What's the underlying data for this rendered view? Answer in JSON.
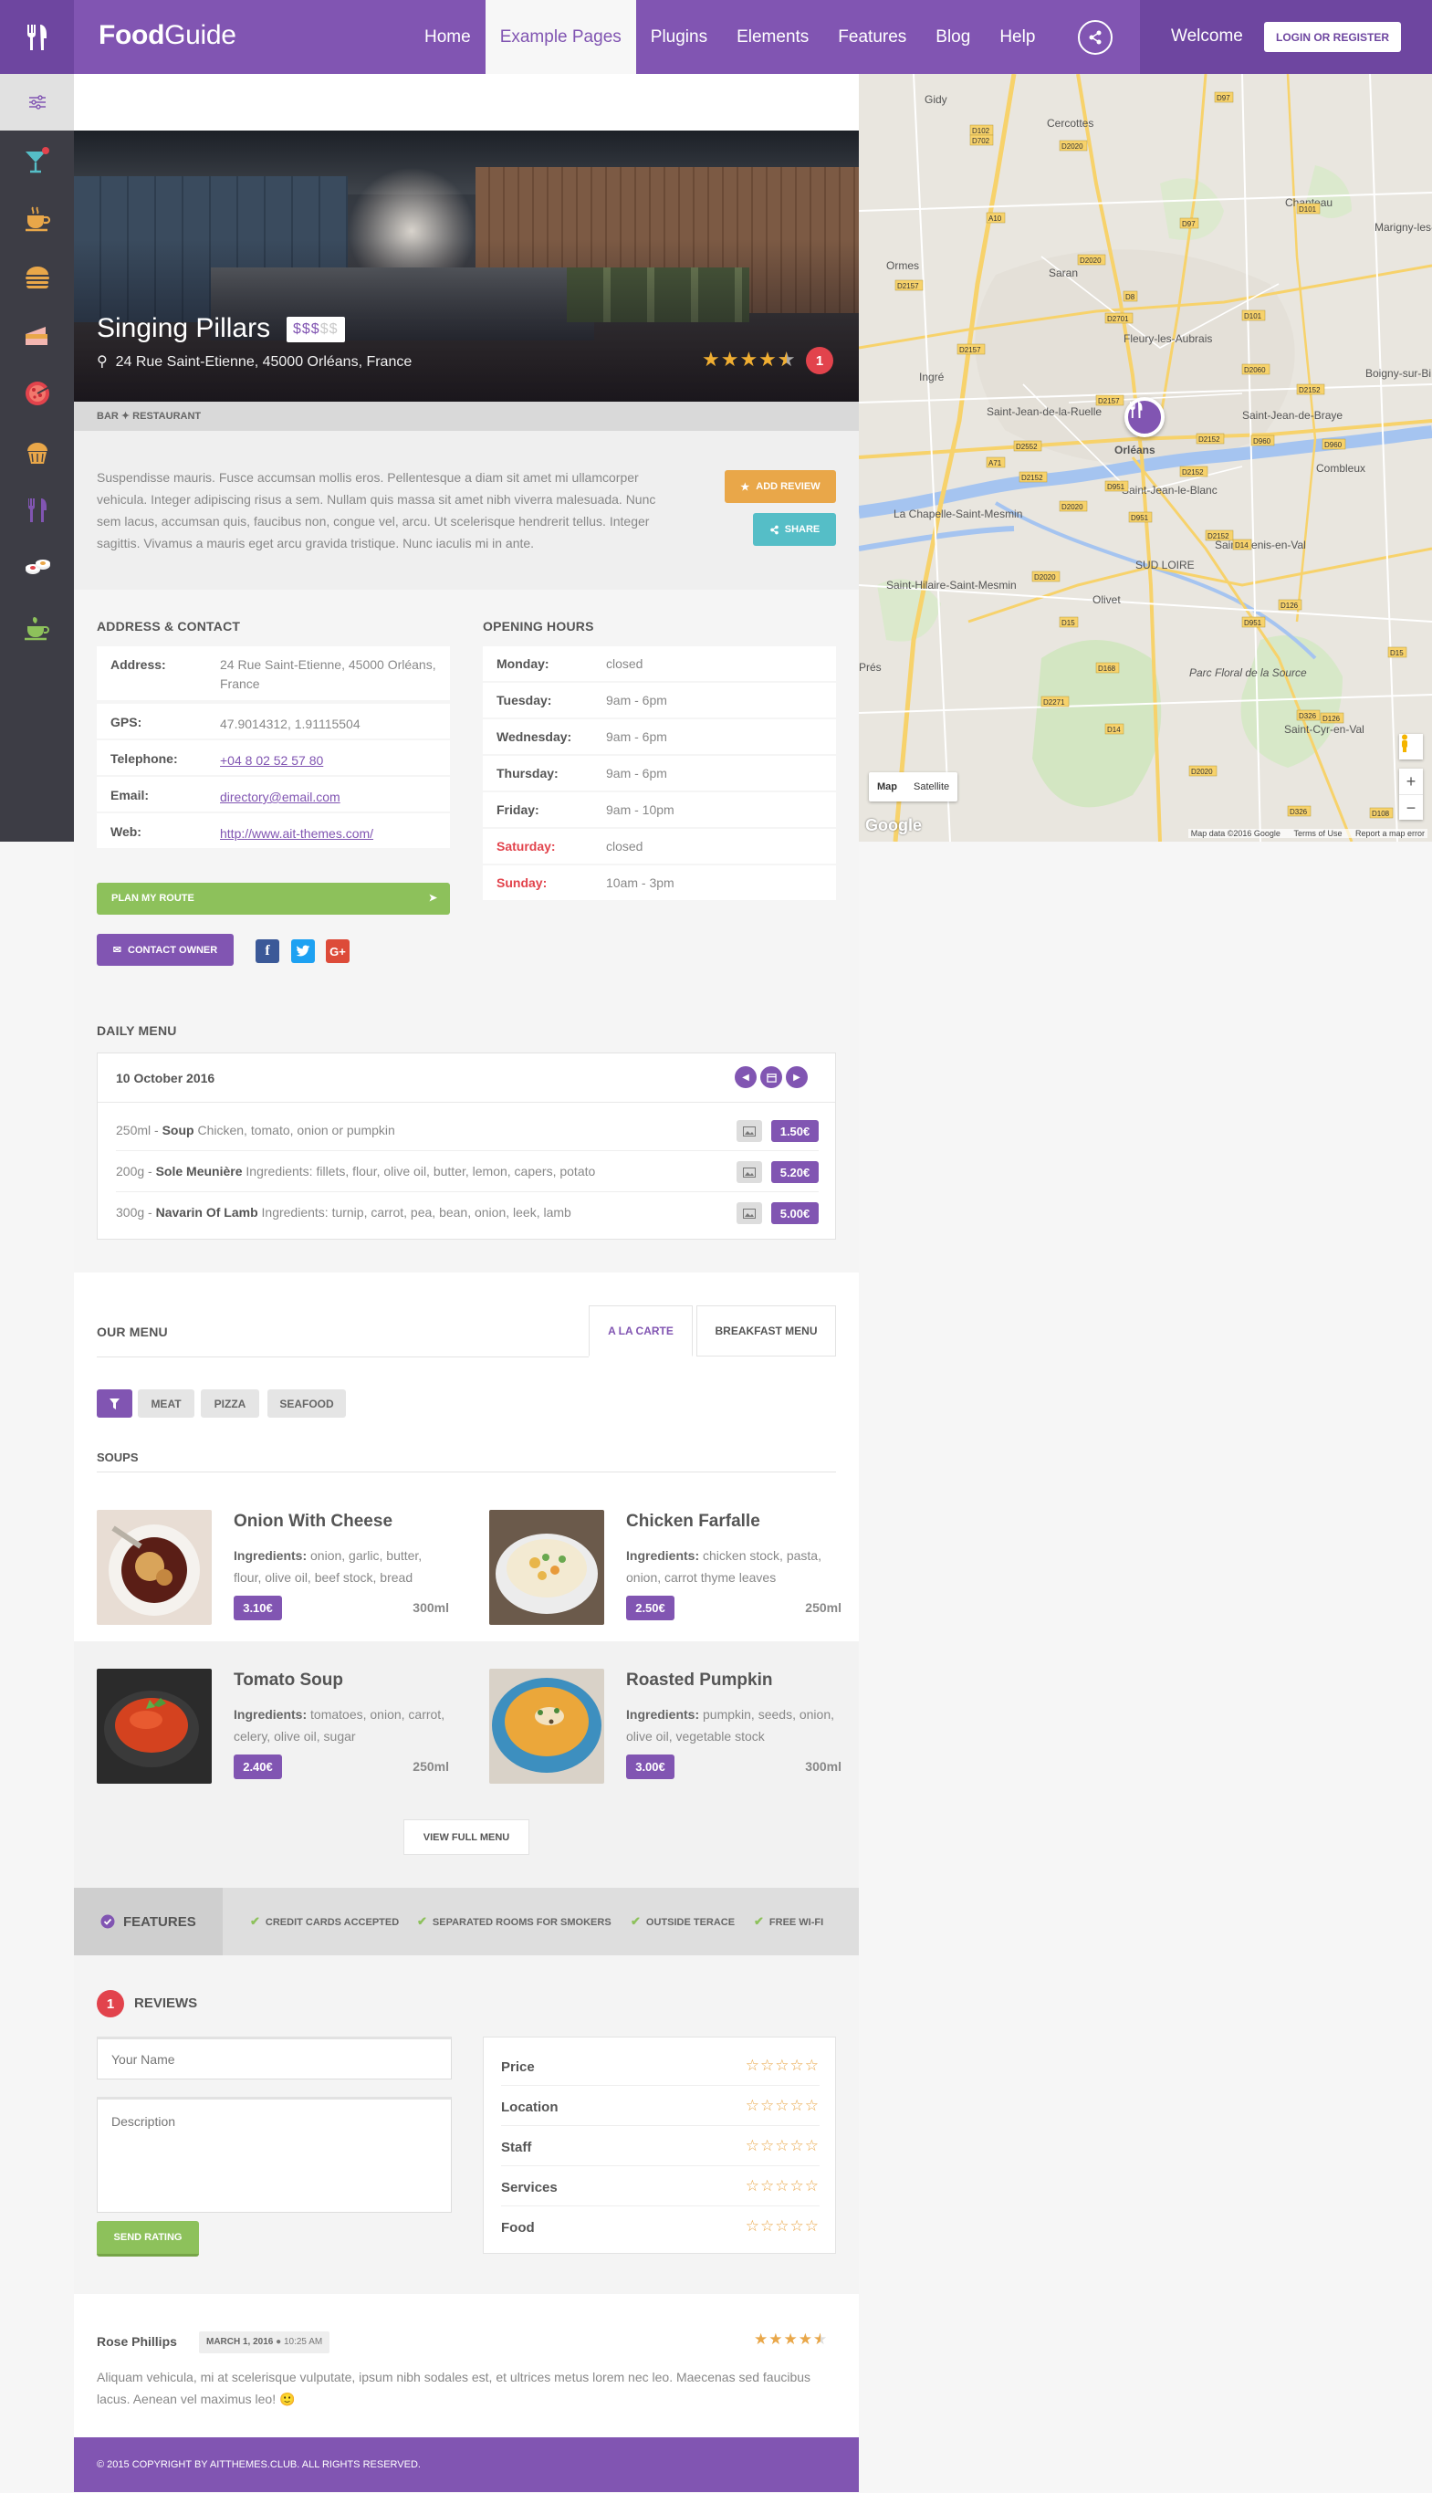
{
  "header": {
    "brand_bold": "Food",
    "brand_light": "Guide",
    "nav": [
      {
        "label": "Home",
        "active": false
      },
      {
        "label": "Example Pages",
        "active": true
      },
      {
        "label": "Plugins",
        "active": false
      },
      {
        "label": "Elements",
        "active": false
      },
      {
        "label": "Features",
        "active": false
      },
      {
        "label": "Blog",
        "active": false
      },
      {
        "label": "Help",
        "active": false
      }
    ],
    "welcome": "Welcome",
    "login_label": "LOGIN OR REGISTER"
  },
  "sidebar": {
    "categories": [
      "cocktail-icon",
      "coffee-icon",
      "burger-icon",
      "cake-icon",
      "pizza-icon",
      "muffin-icon",
      "cutlery-icon",
      "sushi-icon",
      "tea-icon"
    ]
  },
  "listing": {
    "title": "Singing Pillars",
    "price_on": "$$$",
    "price_off": "$$",
    "address": "24 Rue Saint-Etienne, 45000 Orléans, France",
    "rating": 4.5,
    "review_count": "1",
    "categories": "BAR ✦ RESTAURANT",
    "description": "Suspendisse mauris. Fusce accumsan mollis eros. Pellentesque a diam sit amet mi ullamcorper vehicula. Integer adipiscing risus a sem. Nullam quis massa sit amet nibh viverra malesuada. Nunc sem lacus, accumsan quis, faucibus non, congue vel, arcu. Ut scelerisque hendrerit tellus. Integer sagittis. Vivamus a mauris eget arcu gravida tristique. Nunc iaculis mi in ante.",
    "add_review_label": "ADD REVIEW",
    "share_label": "SHARE"
  },
  "contact": {
    "title": "ADDRESS & CONTACT",
    "rows": [
      {
        "label": "Address:",
        "value": "24 Rue Saint-Etienne, 45000 Orléans, France"
      },
      {
        "label": "GPS:",
        "value": "47.9014312, 1.91115504"
      },
      {
        "label": "Telephone:",
        "value": "+04 8 02 52 57 80"
      },
      {
        "label": "Email:",
        "value": "directory@email.com"
      },
      {
        "label": "Web:",
        "value": "http://www.ait-themes.com/"
      }
    ],
    "route_label": "PLAN MY ROUTE",
    "contact_owner_label": "CONTACT OWNER"
  },
  "hours": {
    "title": "OPENING HOURS",
    "rows": [
      {
        "day": "Monday:",
        "time": "closed"
      },
      {
        "day": "Tuesday:",
        "time": "9am - 6pm"
      },
      {
        "day": "Wednesday:",
        "time": "9am - 6pm"
      },
      {
        "day": "Thursday:",
        "time": "9am - 6pm"
      },
      {
        "day": "Friday:",
        "time": "9am - 10pm"
      },
      {
        "day": "Saturday:",
        "time": "closed"
      },
      {
        "day": "Sunday:",
        "time": "10am - 3pm"
      }
    ]
  },
  "daily_menu": {
    "title": "DAILY MENU",
    "date": "10 October 2016",
    "items": [
      {
        "qty": "250ml - ",
        "name": "Soup",
        "desc": " Chicken, tomato, onion or pumpkin",
        "price": "1.50€"
      },
      {
        "qty": "200g - ",
        "name": "Sole Meunière",
        "desc": " Ingredients: fillets, flour, olive oil, butter, lemon, capers, potato",
        "price": "5.20€"
      },
      {
        "qty": "300g - ",
        "name": "Navarin Of Lamb",
        "desc": " Ingredients: turnip, carrot, pea, bean, onion, leek, lamb",
        "price": "5.00€"
      }
    ]
  },
  "our_menu": {
    "title": "OUR MENU",
    "tabs": [
      "A LA CARTE",
      "BREAKFAST MENU"
    ],
    "filters": [
      "MEAT",
      "PIZZA",
      "SEAFOOD"
    ],
    "section": "SOUPS",
    "ingredients_label": "Ingredients:",
    "dishes": [
      {
        "name": "Onion With Cheese",
        "ingredients": " onion, garlic, butter, flour, olive oil, beef stock, bread",
        "price": "3.10€",
        "size": "300ml"
      },
      {
        "name": "Chicken Farfalle",
        "ingredients": " chicken stock, pasta, onion, carrot thyme leaves",
        "price": "2.50€",
        "size": "250ml"
      },
      {
        "name": "Tomato Soup",
        "ingredients": " tomatoes, onion, carrot, celery, olive oil, sugar",
        "price": "2.40€",
        "size": "250ml"
      },
      {
        "name": "Roasted Pumpkin",
        "ingredients": " pumpkin, seeds, onion, olive oil, vegetable stock",
        "price": "3.00€",
        "size": "300ml"
      }
    ],
    "view_full_label": "VIEW FULL MENU"
  },
  "features": {
    "title": "FEATURES",
    "items": [
      "CREDIT CARDS ACCEPTED",
      "SEPARATED ROOMS FOR SMOKERS",
      "OUTSIDE TERACE",
      "FREE WI-FI"
    ]
  },
  "reviews": {
    "title": "REVIEWS",
    "count": "1",
    "name_placeholder": "Your Name",
    "desc_placeholder": "Description",
    "send_label": "SEND RATING",
    "criteria": [
      "Price",
      "Location",
      "Staff",
      "Services",
      "Food"
    ],
    "item": {
      "author": "Rose Phillips",
      "date": "MARCH 1, 2016",
      "time": "10:25 AM",
      "rating": 4.5,
      "text": "Aliquam vehicula, mi at scelerisque vulputate, ipsum nibh sodales est, et ultrices metus lorem nec leo. Maecenas sed faucibus lacus. Aenean vel maximus leo! 🙂"
    }
  },
  "footer": {
    "prefix": "© 2015 COPYRIGHT BY ",
    "link": "AITTHEMES.CLUB",
    "suffix": ". ALL RIGHTS RESERVED."
  },
  "map": {
    "towns": [
      "Gidy",
      "Cercottes",
      "Chanteau",
      "Marigny-les-",
      "Ormes",
      "Saran",
      "Fleury-les-Aubrais",
      "Ingré",
      "Boigny-sur-Bi",
      "Saint-Jean-de-la-Ruelle",
      "Saint-Jean-de-Braye",
      "Orléans",
      "Combleux",
      "La Chapelle-Saint-Mesmin",
      "Saint-Jean-le-Blanc",
      "Saint-Denis-en-Val",
      "Saint-Hilaire-Saint-Mesmin",
      "Olivet",
      "Prés",
      "Parc Floral de la Source",
      "Saint-Cyr-en-Val",
      "SUD LOIRE"
    ],
    "roads": [
      "D97",
      "D102",
      "D702",
      "D2020",
      "A10",
      "D101",
      "D97",
      "D2020",
      "D2157",
      "D8",
      "D101",
      "D2701",
      "D2157",
      "D2060",
      "D2152",
      "D2157",
      "D2152",
      "D960",
      "D960",
      "D2152",
      "D2552",
      "D2152",
      "D951",
      "A71",
      "D2020",
      "D951",
      "D2152",
      "D14",
      "D2020",
      "D126",
      "D15",
      "D951",
      "D168",
      "D2271",
      "D14",
      "D326",
      "D2020",
      "D15",
      "D126",
      "D326",
      "D108"
    ],
    "type_options": [
      "Map",
      "Satellite"
    ],
    "attribution": [
      "Map data ©2016 Google",
      "Terms of Use",
      "Report a map error"
    ],
    "logo": "Google",
    "colors": {
      "water": "#a5c4f0",
      "road_major": "#f7d26b",
      "road_minor": "#ffffff",
      "park": "#c8dfb4"
    }
  },
  "colors": {
    "accent": "#8155b2",
    "accent_dark": "#6e46a0",
    "green": "#8dc15b",
    "orange": "#e9a749",
    "teal": "#55bec7",
    "red": "#e2434c"
  }
}
